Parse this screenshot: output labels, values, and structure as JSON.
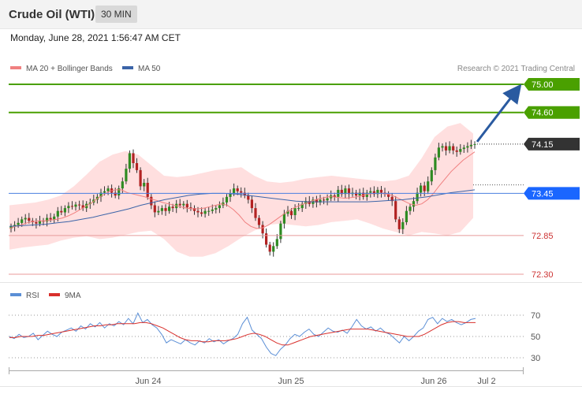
{
  "header": {
    "title": "Crude Oil (WTI)",
    "interval": "30 MIN"
  },
  "timestamp": "Monday, June 28, 2021 1:56:47 AM CET",
  "credit": "Research © 2021 Trading Central",
  "colors": {
    "resistance": "#4aa000",
    "support": "#d9534f",
    "current": "#333333",
    "pivot": "#1a66ff",
    "ma20": "#f08080",
    "ma50": "#3b64a8",
    "band_fill": "#ffd9d9",
    "candle_up": "#2e8b22",
    "candle_down": "#b22222",
    "arrow": "#2a5aa0",
    "rsi": "#5b8fd6",
    "rsi_ma": "#d9302c"
  },
  "chart_data": [
    {
      "type": "candlestick",
      "legend": [
        {
          "label": "MA 20 + Bollinger Bands",
          "color": "#f08080"
        },
        {
          "label": "MA 50",
          "color": "#3b64a8"
        }
      ],
      "levels": [
        {
          "value": 75.0,
          "label": "75.00",
          "kind": "resistance"
        },
        {
          "value": 74.6,
          "label": "74.60",
          "kind": "resistance"
        },
        {
          "value": 74.15,
          "label": "74.15",
          "kind": "current"
        },
        {
          "value": 73.45,
          "label": "73.45",
          "kind": "pivot"
        },
        {
          "value": 72.85,
          "label": "72.85",
          "kind": "support"
        },
        {
          "value": 72.3,
          "label": "72.30",
          "kind": "support"
        }
      ],
      "x_ticks": [
        "Jun 24",
        "Jun 25",
        "Jun 26",
        "Jul 2"
      ],
      "close": [
        72.98,
        73.0,
        73.03,
        73.08,
        73.1,
        73.06,
        73.04,
        73.02,
        73.06,
        73.05,
        73.1,
        73.08,
        73.12,
        73.2,
        73.18,
        73.24,
        73.27,
        73.26,
        73.29,
        73.28,
        73.24,
        73.3,
        73.32,
        73.36,
        73.4,
        73.46,
        73.48,
        73.52,
        73.46,
        73.42,
        73.52,
        73.62,
        73.8,
        74.02,
        73.88,
        73.78,
        73.55,
        73.6,
        73.4,
        73.28,
        73.18,
        73.2,
        73.24,
        73.2,
        73.26,
        73.24,
        73.3,
        73.28,
        73.3,
        73.25,
        73.24,
        73.2,
        73.18,
        73.16,
        73.2,
        73.2,
        73.22,
        73.24,
        73.28,
        73.32,
        73.4,
        73.45,
        73.52,
        73.48,
        73.46,
        73.42,
        73.36,
        73.24,
        73.1,
        73.0,
        72.88,
        72.72,
        72.62,
        72.7,
        72.8,
        73.02,
        73.16,
        73.2,
        73.14,
        73.24,
        73.24,
        73.3,
        73.34,
        73.3,
        73.36,
        73.32,
        73.36,
        73.35,
        73.38,
        73.42,
        73.4,
        73.5,
        73.44,
        73.52,
        73.44,
        73.46,
        73.42,
        73.46,
        73.4,
        73.46,
        73.48,
        73.44,
        73.5,
        73.46,
        73.44,
        73.4,
        73.34,
        73.08,
        72.94,
        73.04,
        73.2,
        73.26,
        73.34,
        73.46,
        73.56,
        73.48,
        73.62,
        73.78,
        73.96,
        74.1,
        74.12,
        74.06,
        74.12,
        74.06,
        74.04,
        74.08,
        74.1,
        74.12,
        74.14,
        74.15
      ],
      "ma20": [
        72.95,
        72.98,
        73.0,
        73.03,
        73.05,
        73.06,
        73.06,
        73.07,
        73.08,
        73.1,
        73.13,
        73.17,
        73.22,
        73.27,
        73.32,
        73.38,
        73.43,
        73.48,
        73.5,
        73.5,
        73.46,
        73.44,
        73.42,
        73.4,
        73.37,
        73.35,
        73.32,
        73.3,
        73.28,
        73.26,
        73.24,
        73.23,
        73.23,
        73.24,
        73.26,
        73.28,
        73.3,
        73.28,
        73.22,
        73.14,
        73.04,
        72.98,
        72.95,
        72.96,
        73.0,
        73.06,
        73.12,
        73.18,
        73.23,
        73.27,
        73.3,
        73.33,
        73.36,
        73.38,
        73.4,
        73.4,
        73.39,
        73.38,
        73.39,
        73.4,
        73.42,
        73.44,
        73.45,
        73.45,
        73.44,
        73.42,
        73.38,
        73.34,
        73.3,
        73.28,
        73.3,
        73.36,
        73.45,
        73.56,
        73.66,
        73.76,
        73.84,
        73.92,
        73.98,
        74.04
      ],
      "ma50": [
        72.98,
        72.99,
        73.0,
        73.01,
        73.03,
        73.05,
        73.08,
        73.11,
        73.15,
        73.19,
        73.23,
        73.28,
        73.32,
        73.36,
        73.39,
        73.42,
        73.44,
        73.45,
        73.45,
        73.44,
        73.42,
        73.4,
        73.38,
        73.36,
        73.34,
        73.33,
        73.33,
        73.33,
        73.33,
        73.33,
        73.33,
        73.34,
        73.35,
        73.36,
        73.38,
        73.4,
        73.43,
        73.46,
        73.48,
        73.5
      ],
      "band_upper": [
        73.28,
        73.3,
        73.32,
        73.36,
        73.42,
        73.55,
        73.72,
        73.9,
        74.0,
        74.05,
        74.0,
        73.85,
        73.7,
        73.68,
        73.7,
        73.74,
        73.78,
        73.8,
        73.82,
        73.7,
        73.62,
        73.6,
        73.62,
        73.66,
        73.68,
        73.7,
        73.68,
        73.66,
        73.64,
        73.62,
        73.64,
        73.7,
        73.95,
        74.25,
        74.4,
        74.45,
        74.3
      ],
      "band_lower": [
        72.65,
        72.68,
        72.7,
        72.72,
        72.78,
        72.82,
        72.84,
        72.8,
        72.82,
        72.86,
        72.9,
        72.92,
        72.8,
        72.62,
        72.55,
        72.55,
        72.6,
        72.7,
        72.82,
        72.92,
        73.0,
        73.02,
        73.0,
        72.98,
        73.0,
        73.04,
        73.06,
        73.08,
        73.02,
        72.95,
        72.9,
        72.85,
        72.9,
        72.88,
        72.85,
        72.9,
        73.1
      ]
    },
    {
      "type": "line",
      "legend": [
        {
          "label": "RSI",
          "color": "#5b8fd6"
        },
        {
          "label": "9MA",
          "color": "#d9302c"
        }
      ],
      "ylim": [
        20,
        80
      ],
      "y_ticks": [
        "70",
        "50",
        "30"
      ],
      "rsi": [
        50,
        48,
        52,
        49,
        50,
        53,
        47,
        51,
        55,
        52,
        50,
        54,
        56,
        58,
        55,
        60,
        57,
        62,
        59,
        63,
        58,
        62,
        60,
        64,
        61,
        67,
        62,
        72,
        63,
        66,
        61,
        58,
        52,
        44,
        47,
        45,
        43,
        47,
        44,
        42,
        46,
        44,
        48,
        45,
        47,
        43,
        46,
        48,
        52,
        62,
        68,
        56,
        52,
        48,
        40,
        34,
        32,
        38,
        42,
        48,
        52,
        50,
        54,
        57,
        52,
        50,
        54,
        58,
        55,
        54,
        56,
        53,
        59,
        66,
        60,
        57,
        59,
        55,
        58,
        54,
        52,
        48,
        44,
        50,
        46,
        50,
        55,
        58,
        66,
        68,
        62,
        67,
        64,
        66,
        63,
        61,
        63,
        66,
        67
      ],
      "rsi_ma": [
        49,
        49,
        50,
        50,
        50,
        51,
        51,
        52,
        53,
        54,
        55,
        56,
        57,
        58,
        59,
        60,
        60,
        61,
        61,
        62,
        62,
        62,
        62,
        63,
        63,
        62,
        60,
        58,
        55,
        52,
        49,
        47,
        46,
        46,
        45,
        45,
        46,
        46,
        46,
        47,
        48,
        50,
        52,
        53,
        52,
        50,
        47,
        44,
        42,
        42,
        44,
        46,
        48,
        50,
        51,
        52,
        53,
        54,
        55,
        56,
        57,
        57,
        57,
        57,
        56,
        55,
        54,
        53,
        52,
        51,
        50,
        50,
        50,
        52,
        55,
        58,
        61,
        63,
        64,
        64,
        63,
        63,
        63
      ]
    }
  ]
}
